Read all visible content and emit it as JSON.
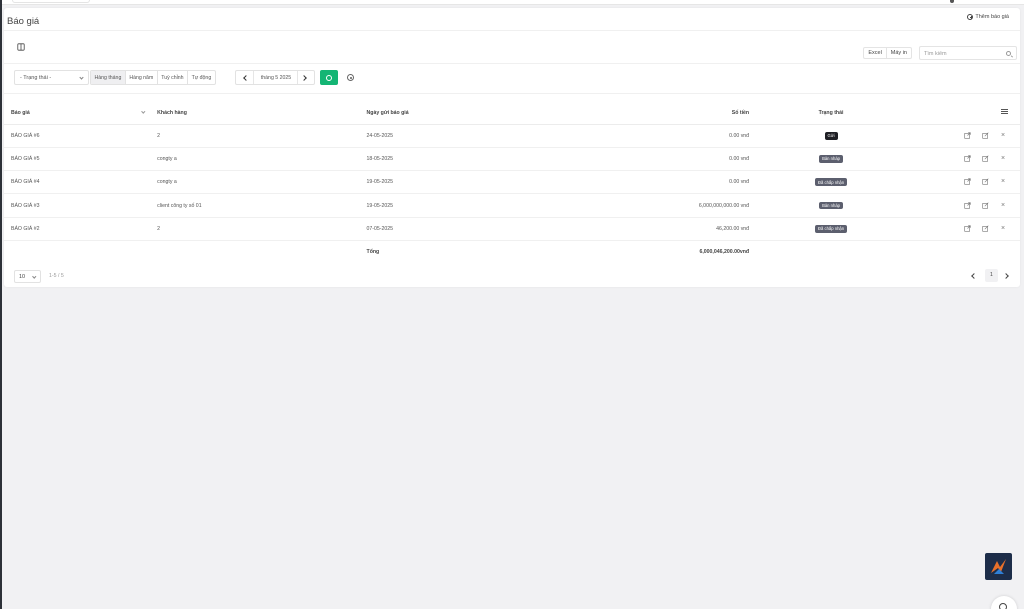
{
  "page": {
    "title": "Báo giá",
    "add_label": "Thêm báo giá"
  },
  "toolbar": {
    "excel_label": "Excel",
    "print_label": "Máy in",
    "search_placeholder": "Tìm kiếm"
  },
  "filters": {
    "status_value": "- Trạng thái -",
    "periods": [
      "Hàng tháng",
      "Hàng năm",
      "Tuỳ chỉnh",
      "Tự động"
    ],
    "active_period": "Hàng tháng",
    "date_label": "tháng 5 2025"
  },
  "table": {
    "columns": [
      "Báo giá",
      "Khách hàng",
      "Ngày gửi báo giá",
      "Số tiền",
      "Trạng thái"
    ],
    "rows": [
      {
        "id": "BÁO GIÁ #6",
        "client": "2",
        "date": "24-05-2025",
        "amount": "0.00 vnđ",
        "status": "Gửi",
        "status_style": "dark"
      },
      {
        "id": "BÁO GIÁ #5",
        "client": "congty a",
        "date": "18-05-2025",
        "amount": "0.00 vnđ",
        "status": "Bản nháp",
        "status_style": "gray"
      },
      {
        "id": "BÁO GIÁ #4",
        "client": "congty a",
        "date": "19-05-2025",
        "amount": "0.00 vnđ",
        "status": "Đã chấp nhận",
        "status_style": "gray"
      },
      {
        "id": "BÁO GIÁ #3",
        "client": "client công ty số 01",
        "date": "19-05-2025",
        "amount": "6,000,000,000.00 vnđ",
        "status": "Bản nháp",
        "status_style": "gray"
      },
      {
        "id": "BÁO GIÁ #2",
        "client": "2",
        "date": "07-05-2025",
        "amount": "46,200.00 vnđ",
        "status": "Đã chấp nhận",
        "status_style": "gray"
      }
    ],
    "total_label": "Tổng",
    "total_value": "6,000,046,200.00vnđ"
  },
  "pagination": {
    "page_size": "10",
    "range": "1-5 / 5",
    "current_page": "1"
  },
  "colors": {
    "accent_green": "#14b574",
    "badge_gray": "#5c5f6e",
    "badge_dark": "#1e1f24"
  }
}
